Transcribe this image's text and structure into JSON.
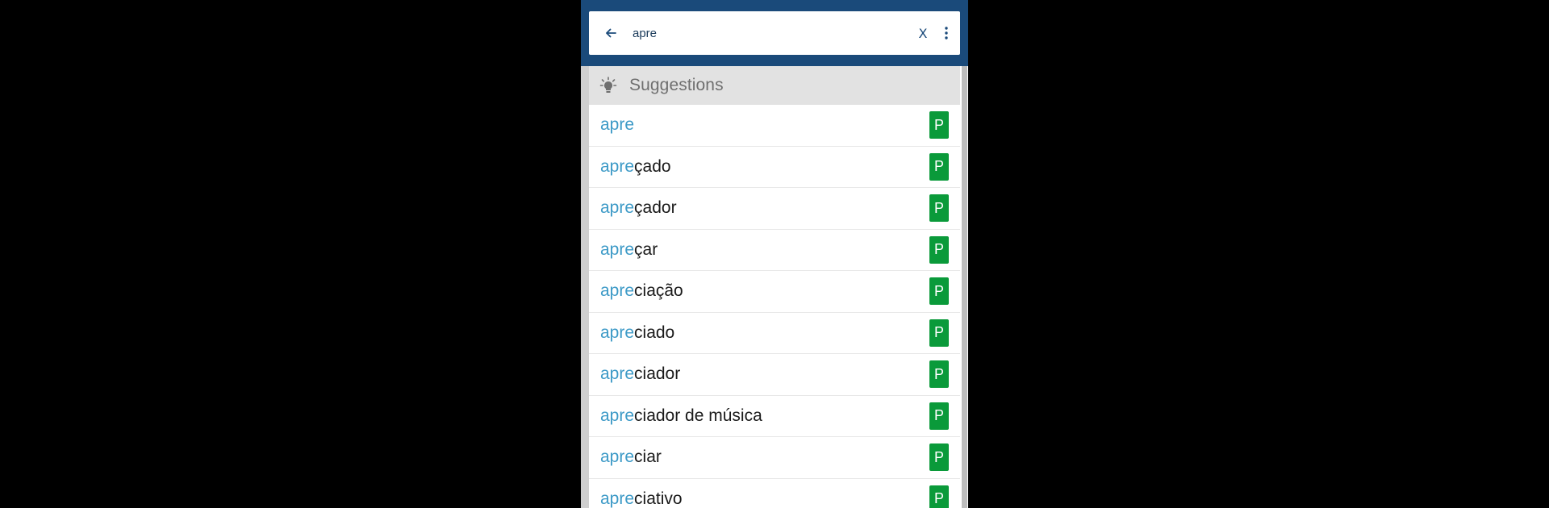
{
  "search": {
    "query": "apre",
    "clear_label": "X"
  },
  "suggestions": {
    "title": "Suggestions",
    "items": [
      {
        "prefix": "apre",
        "rest": "",
        "badge": "P"
      },
      {
        "prefix": "apre",
        "rest": "çado",
        "badge": "P"
      },
      {
        "prefix": "apre",
        "rest": "çador",
        "badge": "P"
      },
      {
        "prefix": "apre",
        "rest": "çar",
        "badge": "P"
      },
      {
        "prefix": "apre",
        "rest": "ciação",
        "badge": "P"
      },
      {
        "prefix": "apre",
        "rest": "ciado",
        "badge": "P"
      },
      {
        "prefix": "apre",
        "rest": "ciador",
        "badge": "P"
      },
      {
        "prefix": "apre",
        "rest": "ciador de música",
        "badge": "P"
      },
      {
        "prefix": "apre",
        "rest": "ciar",
        "badge": "P"
      },
      {
        "prefix": "apre",
        "rest": "ciativo",
        "badge": "P"
      }
    ]
  },
  "colors": {
    "appbar": "#1a4a7a",
    "highlight": "#3d9ac7",
    "badge": "#0a9a3a",
    "header_bg": "#e2e2e2"
  },
  "icons": {
    "back": "arrow-left-icon",
    "clear": "close-icon",
    "more": "more-vert-icon",
    "suggestions": "lightbulb-icon"
  }
}
